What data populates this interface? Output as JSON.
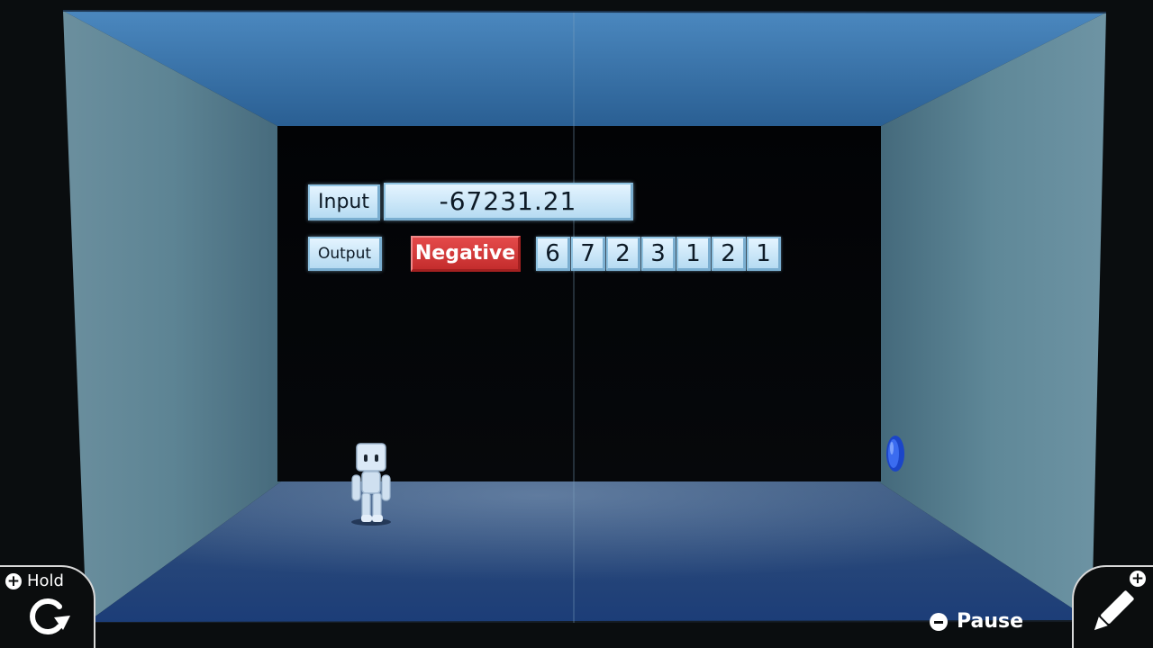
{
  "scene": {
    "input_label": "Input",
    "input_value": "-67231.21",
    "output_label": "Output",
    "output_sign": "Negative",
    "output_digits": [
      "6",
      "7",
      "2",
      "3",
      "1",
      "2",
      "1"
    ]
  },
  "hud": {
    "hold_label": "Hold",
    "pause_label": "Pause",
    "hold_icon": "rotate-icon",
    "edit_icon": "pencil-icon"
  },
  "colors": {
    "panel": "#c8e6f8",
    "negative_badge": "#d63a3a",
    "room_blue": "#3a74a8"
  }
}
